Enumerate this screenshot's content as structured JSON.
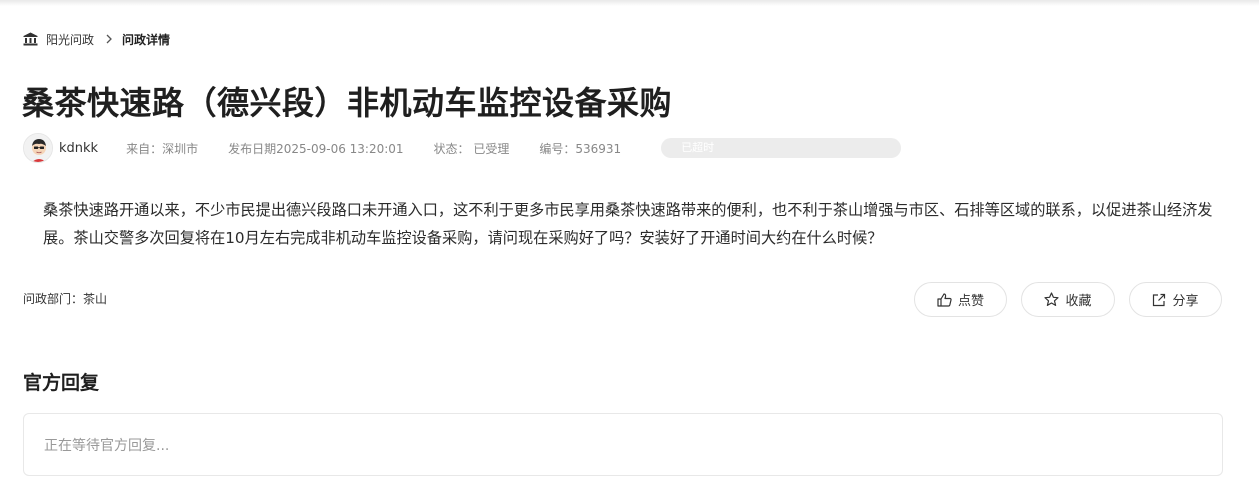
{
  "breadcrumb": {
    "home_icon": "bank-icon",
    "home_label": "阳光问政",
    "separator_icon": "chevron-right-icon",
    "current": "问政详情"
  },
  "post": {
    "title": "桑茶快速路（德兴段）非机动车监控设备采购",
    "author": "kdnkk",
    "source": "来自：深圳市",
    "date": "发布日期2025-09-06 13:20:01",
    "status": "状态：  已受理",
    "number": "编号：536931",
    "status_pill": "已超时",
    "content": "桑茶快速路开通以来，不少市民提出德兴段路口未开通入口，这不利于更多市民享用桑茶快速路带来的便利，也不利于茶山增强与市区、石排等区域的联系，以促进茶山经济发展。茶山交警多次回复将在10月左右完成非机动车监控设备采购，请问现在采购好了吗？安装好了开通时间大约在什么时候？",
    "department": "问政部门：茶山"
  },
  "actions": {
    "like_label": "点赞",
    "like_icon": "thumbs-up-icon",
    "favorite_label": "收藏",
    "favorite_icon": "star-icon",
    "share_label": "分享",
    "share_icon": "share-icon"
  },
  "reply": {
    "title": "官方回复",
    "placeholder": "正在等待官方回复..."
  }
}
